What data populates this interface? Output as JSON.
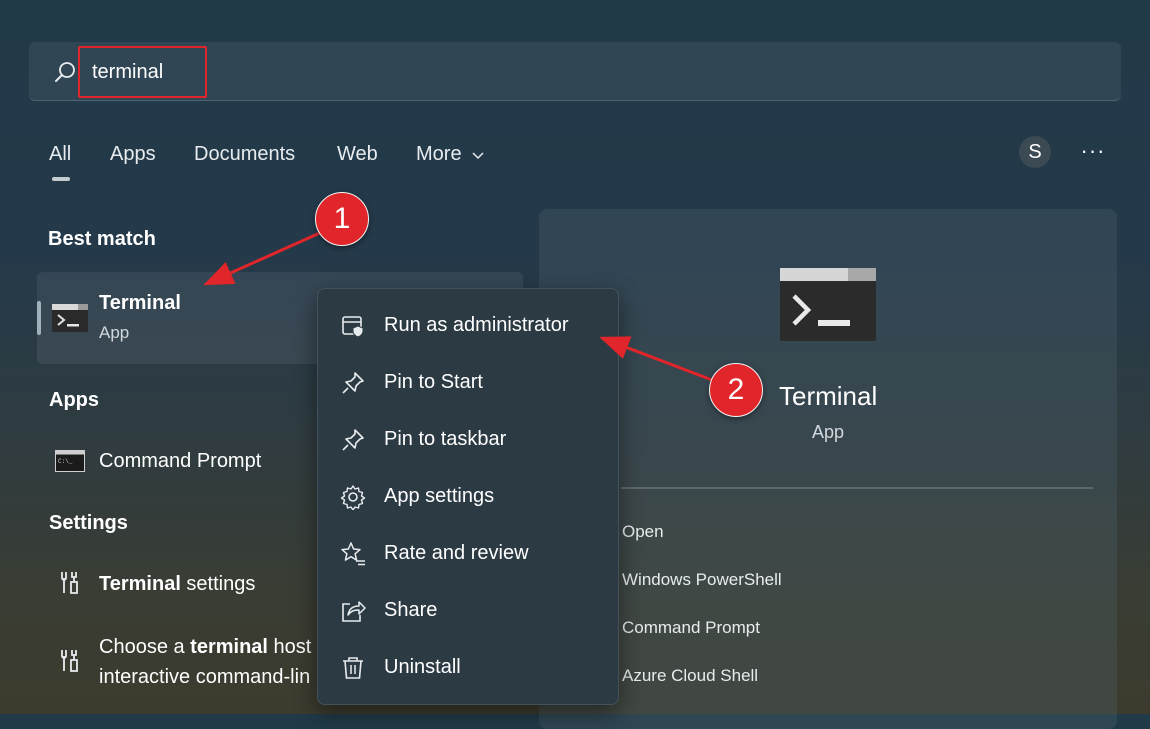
{
  "search": {
    "value": "terminal"
  },
  "tabs": [
    {
      "label": "All"
    },
    {
      "label": "Apps"
    },
    {
      "label": "Documents"
    },
    {
      "label": "Web"
    },
    {
      "label": "More"
    }
  ],
  "header": {
    "avatar_letter": "S",
    "more_options": "···"
  },
  "best_match": {
    "title": "Best match",
    "name": "Terminal",
    "type": "App"
  },
  "apps": {
    "title": "Apps",
    "items": [
      {
        "label": "Command Prompt"
      }
    ]
  },
  "settings": {
    "title": "Settings",
    "items": [
      {
        "bold": "Terminal",
        "rest": " settings"
      },
      {
        "line1_pre": "Choose a ",
        "line1_bold": "terminal",
        "line1_post": " host",
        "line2": "interactive command-lin"
      }
    ]
  },
  "context_menu": {
    "items": [
      {
        "label": "Run as administrator",
        "icon": "shield-icon"
      },
      {
        "label": "Pin to Start",
        "icon": "pin-icon"
      },
      {
        "label": "Pin to taskbar",
        "icon": "pin-icon"
      },
      {
        "label": "App settings",
        "icon": "gear-icon"
      },
      {
        "label": "Rate and review",
        "icon": "star-icon"
      },
      {
        "label": "Share",
        "icon": "share-icon"
      },
      {
        "label": "Uninstall",
        "icon": "trash-icon"
      }
    ]
  },
  "detail_panel": {
    "name": "Terminal",
    "type": "App",
    "actions": [
      {
        "label": "Open"
      },
      {
        "label": "Windows PowerShell"
      },
      {
        "label": "Command Prompt"
      },
      {
        "label": "Azure Cloud Shell"
      }
    ]
  },
  "annotations": {
    "step1": "1",
    "step2": "2",
    "color": "#e0262a"
  }
}
